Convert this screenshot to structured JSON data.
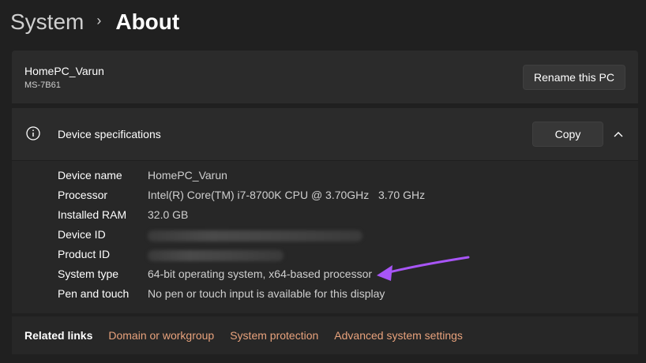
{
  "breadcrumb": {
    "parent": "System",
    "separator": "›",
    "current": "About"
  },
  "pc": {
    "name": "HomePC_Varun",
    "model": "MS-7B61",
    "rename_label": "Rename this PC"
  },
  "specs": {
    "title": "Device specifications",
    "copy_label": "Copy",
    "rows": [
      {
        "label": "Device name",
        "value": "HomePC_Varun"
      },
      {
        "label": "Processor",
        "value": "Intel(R) Core(TM) i7-8700K CPU @ 3.70GHz   3.70 GHz"
      },
      {
        "label": "Installed RAM",
        "value": "32.0 GB"
      },
      {
        "label": "Device ID",
        "value": ""
      },
      {
        "label": "Product ID",
        "value": ""
      },
      {
        "label": "System type",
        "value": "64-bit operating system, x64-based processor"
      },
      {
        "label": "Pen and touch",
        "value": "No pen or touch input is available for this display"
      }
    ]
  },
  "related": {
    "title": "Related links",
    "links": [
      "Domain or workgroup",
      "System protection",
      "Advanced system settings"
    ]
  },
  "colors": {
    "background": "#202020",
    "card": "#2b2b2b",
    "link": "#e8a27c",
    "arrow": "#a855f7"
  },
  "icons": {
    "specs": "info-icon",
    "collapse": "chevron-up-icon",
    "breadcrumb_separator": "chevron-right-icon",
    "annotation": "arrow-annotation-icon"
  }
}
